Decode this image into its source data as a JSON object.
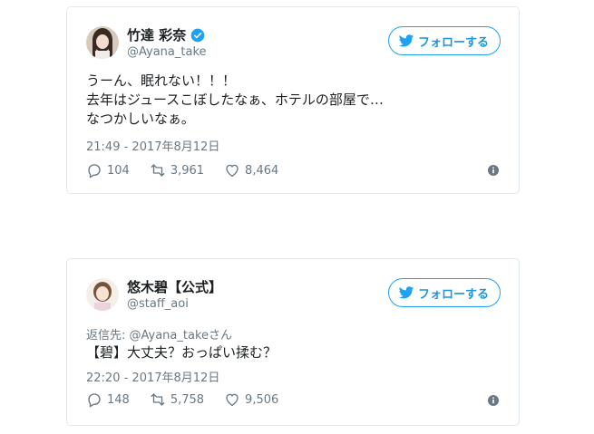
{
  "tweets": [
    {
      "display_name": "竹達 彩奈",
      "handle": "@Ayana_take",
      "verified": true,
      "follow_label": "フォローする",
      "reply_to": "",
      "lines": [
        "うーん、眠れない！！！",
        "去年はジュースこぼしたなぁ、ホテルの部屋で…",
        "なつかしいなぁ。"
      ],
      "timestamp": "21:49 - 2017年8月12日",
      "replies": "104",
      "retweets": "3,961",
      "likes": "8,464"
    },
    {
      "display_name": "悠木碧【公式】",
      "handle": "@staff_aoi",
      "verified": false,
      "follow_label": "フォローする",
      "reply_to": "返信先: @Ayana_takeさん",
      "lines": [
        "【碧】大丈夫？おっぱい揉む？"
      ],
      "timestamp": "22:20 - 2017年8月12日",
      "replies": "148",
      "retweets": "5,758",
      "likes": "9,506"
    }
  ],
  "colors": {
    "accent": "#1da1f2",
    "secondary_text": "#697882",
    "border": "#e1e8ed"
  },
  "icons": [
    "bird-icon",
    "verified-badge-icon",
    "reply-icon",
    "retweet-icon",
    "like-icon",
    "info-icon"
  ]
}
